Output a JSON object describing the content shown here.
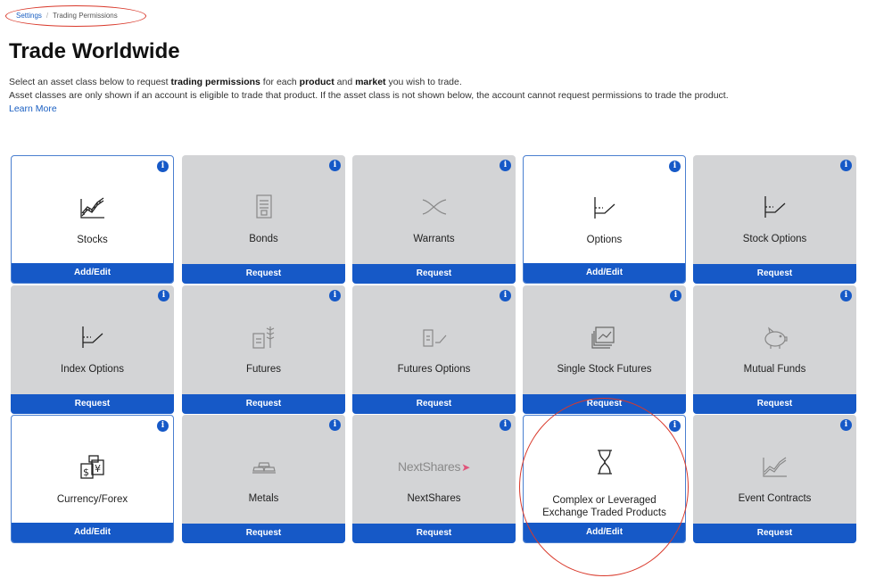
{
  "breadcrumb": {
    "parent": "Settings",
    "separator": "/",
    "current": "Trading Permissions"
  },
  "page": {
    "title": "Trade Worldwide",
    "intro_1a": "Select an asset class below to request ",
    "intro_1b": "trading permissions",
    "intro_1c": " for each ",
    "intro_1d": "product",
    "intro_1e": " and ",
    "intro_1f": "market",
    "intro_1g": " you wish to trade.",
    "intro_2": "Asset classes are only shown if an account is eligible to trade that product. If the asset class is not shown below, the account cannot request permissions to trade the product.",
    "learn_more": "Learn More"
  },
  "info_glyph": "i",
  "tiles": [
    {
      "label": "Stocks",
      "action": "Add/Edit",
      "icon": "stock-chart-icon",
      "active": true
    },
    {
      "label": "Bonds",
      "action": "Request",
      "icon": "bond-document-icon",
      "active": false
    },
    {
      "label": "Warrants",
      "action": "Request",
      "icon": "crossing-lines-icon",
      "active": false
    },
    {
      "label": "Options",
      "action": "Add/Edit",
      "icon": "option-payoff-icon",
      "active": true
    },
    {
      "label": "Stock Options",
      "action": "Request",
      "icon": "option-payoff-icon",
      "active": false
    },
    {
      "label": "Index Options",
      "action": "Request",
      "icon": "option-payoff-icon",
      "active": false
    },
    {
      "label": "Futures",
      "action": "Request",
      "icon": "wheat-icon",
      "active": false
    },
    {
      "label": "Futures Options",
      "action": "Request",
      "icon": "futures-option-icon",
      "active": false
    },
    {
      "label": "Single Stock Futures",
      "action": "Request",
      "icon": "certificates-icon",
      "active": false
    },
    {
      "label": "Mutual Funds",
      "action": "Request",
      "icon": "piggy-bank-icon",
      "active": false
    },
    {
      "label": "Currency/Forex",
      "action": "Add/Edit",
      "icon": "currency-icon",
      "active": true
    },
    {
      "label": "Metals",
      "action": "Request",
      "icon": "gold-bars-icon",
      "active": false
    },
    {
      "label": "NextShares",
      "action": "Request",
      "icon": "nextshares-logo",
      "logo_text": "NextShares",
      "logo_arrow": "➤",
      "active": false
    },
    {
      "label": "Complex or Leveraged Exchange Traded Products",
      "action": "Add/Edit",
      "icon": "hourglass-icon",
      "active": true
    },
    {
      "label": "Event Contracts",
      "action": "Request",
      "icon": "event-chart-icon",
      "active": false
    }
  ]
}
